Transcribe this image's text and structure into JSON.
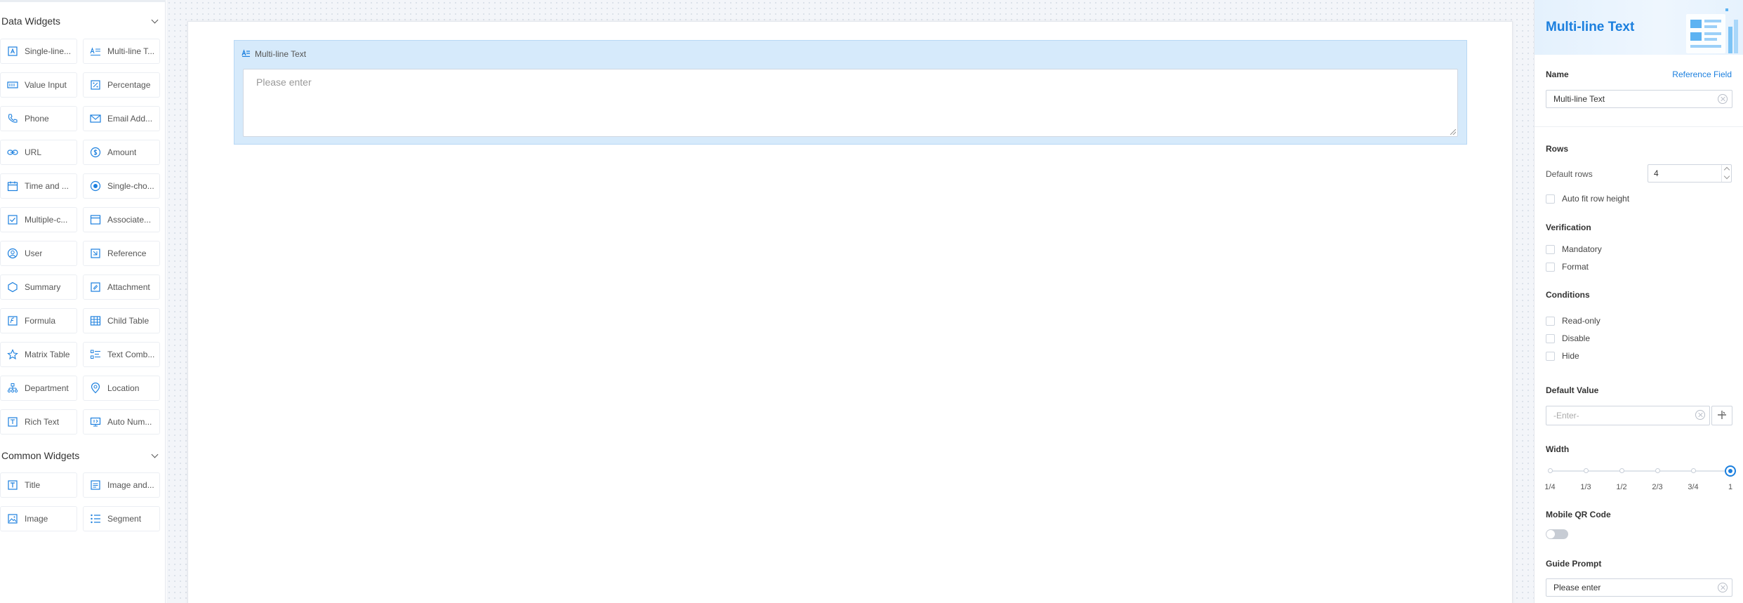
{
  "sidebar": {
    "data_widgets_title": "Data Widgets",
    "data_widgets": [
      {
        "label": "Single-line...",
        "icon": "single-line-text-icon"
      },
      {
        "label": "Multi-line T...",
        "icon": "multi-line-text-icon"
      },
      {
        "label": "Value Input",
        "icon": "value-input-icon"
      },
      {
        "label": "Percentage",
        "icon": "percentage-icon"
      },
      {
        "label": "Phone",
        "icon": "phone-icon"
      },
      {
        "label": "Email Add...",
        "icon": "email-icon"
      },
      {
        "label": "URL",
        "icon": "link-icon"
      },
      {
        "label": "Amount",
        "icon": "amount-icon"
      },
      {
        "label": "Time and ...",
        "icon": "calendar-icon"
      },
      {
        "label": "Single-cho...",
        "icon": "radio-icon"
      },
      {
        "label": "Multiple-c...",
        "icon": "checkbox-icon"
      },
      {
        "label": "Associate...",
        "icon": "associate-icon"
      },
      {
        "label": "User",
        "icon": "user-icon"
      },
      {
        "label": "Reference",
        "icon": "reference-icon"
      },
      {
        "label": "Summary",
        "icon": "summary-icon"
      },
      {
        "label": "Attachment",
        "icon": "attachment-icon"
      },
      {
        "label": "Formula",
        "icon": "formula-icon"
      },
      {
        "label": "Child Table",
        "icon": "table-icon"
      },
      {
        "label": "Matrix Table",
        "icon": "matrix-icon"
      },
      {
        "label": "Text Comb...",
        "icon": "text-combination-icon"
      },
      {
        "label": "Department",
        "icon": "department-icon"
      },
      {
        "label": "Location",
        "icon": "location-icon"
      },
      {
        "label": "Rich Text",
        "icon": "rich-text-icon"
      },
      {
        "label": "Auto Num...",
        "icon": "auto-number-icon"
      }
    ],
    "common_widgets_title": "Common Widgets",
    "common_widgets": [
      {
        "label": "Title",
        "icon": "title-icon"
      },
      {
        "label": "Image and...",
        "icon": "image-text-icon"
      },
      {
        "label": "Image",
        "icon": "image-icon"
      },
      {
        "label": "Segment",
        "icon": "segment-icon"
      }
    ]
  },
  "canvas": {
    "field_label": "Multi-line Text",
    "field_placeholder": "Please enter"
  },
  "properties": {
    "title": "Multi-line Text",
    "name_label": "Name",
    "reference_field_link": "Reference Field",
    "name_value": "Multi-line Text",
    "rows_section": "Rows",
    "default_rows_label": "Default rows",
    "default_rows_value": "4",
    "auto_fit_label": "Auto fit row height",
    "verification_section": "Verification",
    "mandatory_label": "Mandatory",
    "format_label": "Format",
    "conditions_section": "Conditions",
    "readonly_label": "Read-only",
    "disable_label": "Disable",
    "hide_label": "Hide",
    "default_value_section": "Default Value",
    "default_value_placeholder": "-Enter-",
    "width_section": "Width",
    "width_options": [
      "1/4",
      "1/3",
      "1/2",
      "2/3",
      "3/4",
      "1"
    ],
    "width_selected": "1",
    "mobile_qr_section": "Mobile QR Code",
    "mobile_qr_enabled": false,
    "guide_prompt_section": "Guide Prompt",
    "guide_prompt_value": "Please enter"
  },
  "colors": {
    "accent": "#1b7fde",
    "selected_field_bg": "#d6eafb",
    "canvas_bg": "#f3f5f9"
  }
}
